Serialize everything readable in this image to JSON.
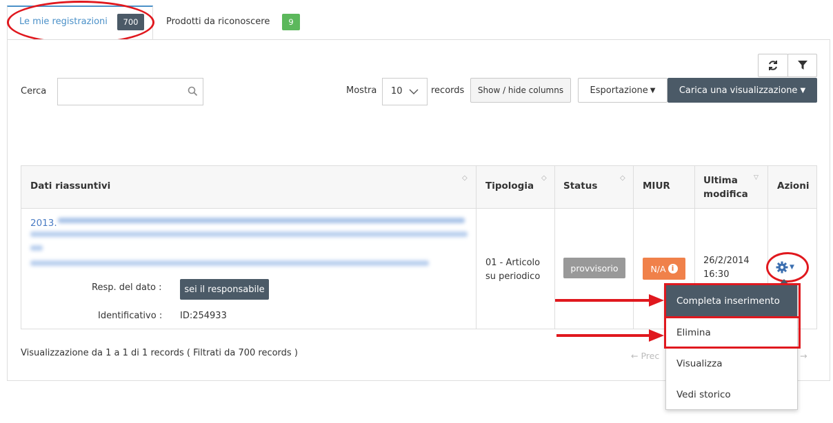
{
  "tabs": [
    {
      "label": "Le mie registrazioni",
      "count": "700"
    },
    {
      "label": "Prodotti da riconoscere",
      "count": "9"
    }
  ],
  "toolbar": {
    "search_label": "Cerca",
    "search_value": "",
    "show_label": "Mostra",
    "show_value": "10",
    "records_label": "records",
    "columns_button": "Show / hide columns",
    "export_button": "Esportazione",
    "load_view_button": "Carica una visualizzazione"
  },
  "table": {
    "headers": [
      "Dati riassuntivi",
      "Tipologia",
      "Status",
      "MIUR",
      "Ultima modifica",
      "Azioni"
    ],
    "row": {
      "year": "2013.",
      "resp_label": "Resp. del dato :",
      "resp_button": "sei il responsabile",
      "id_label": "Identificativo :",
      "id_value": "ID:254933",
      "tipologia": "01 - Articolo su periodico",
      "status": "provvisorio",
      "miur": "N/A",
      "date": "26/2/2014",
      "time": "16:30"
    }
  },
  "footer": {
    "info": "Visualizzazione da 1 a 1 di 1 records ( Filtrati da 700 records )",
    "prev": "← Prec"
  },
  "actions_menu": [
    "Completa inserimento",
    "Elimina",
    "Visualizza",
    "Vedi storico"
  ],
  "colors": {
    "accent": "#4a90c8",
    "dark": "#4b5a67",
    "success": "#5cb85c",
    "warning": "#f0814a",
    "annotation": "#e0181e"
  }
}
